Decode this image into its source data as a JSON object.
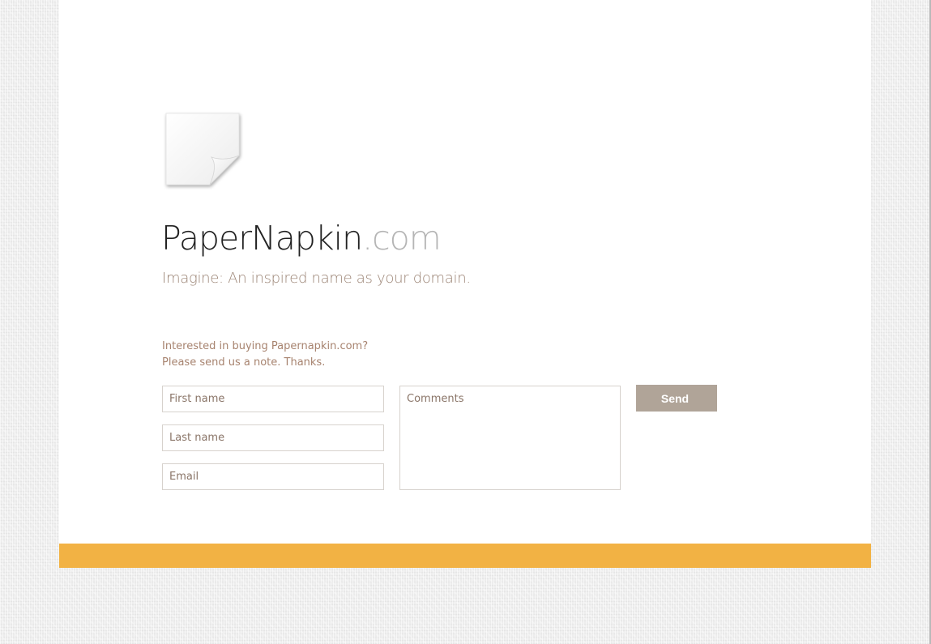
{
  "brand": {
    "name": "PaperNapkin",
    "tld": ".com",
    "tagline": "Imagine: An inspired name as your domain."
  },
  "intro": {
    "line1": "Interested in buying Papernapkin.com?",
    "line2": "Please send us a note. Thanks."
  },
  "form": {
    "first_name_placeholder": "First name",
    "last_name_placeholder": "Last name",
    "email_placeholder": "Email",
    "comments_placeholder": "Comments",
    "send_label": "Send"
  },
  "colors": {
    "accent_bar": "#f2b244",
    "send_button": "#b0a498",
    "muted_text": "#a7836f"
  },
  "icons": {
    "logo": "paper-napkin-icon"
  }
}
